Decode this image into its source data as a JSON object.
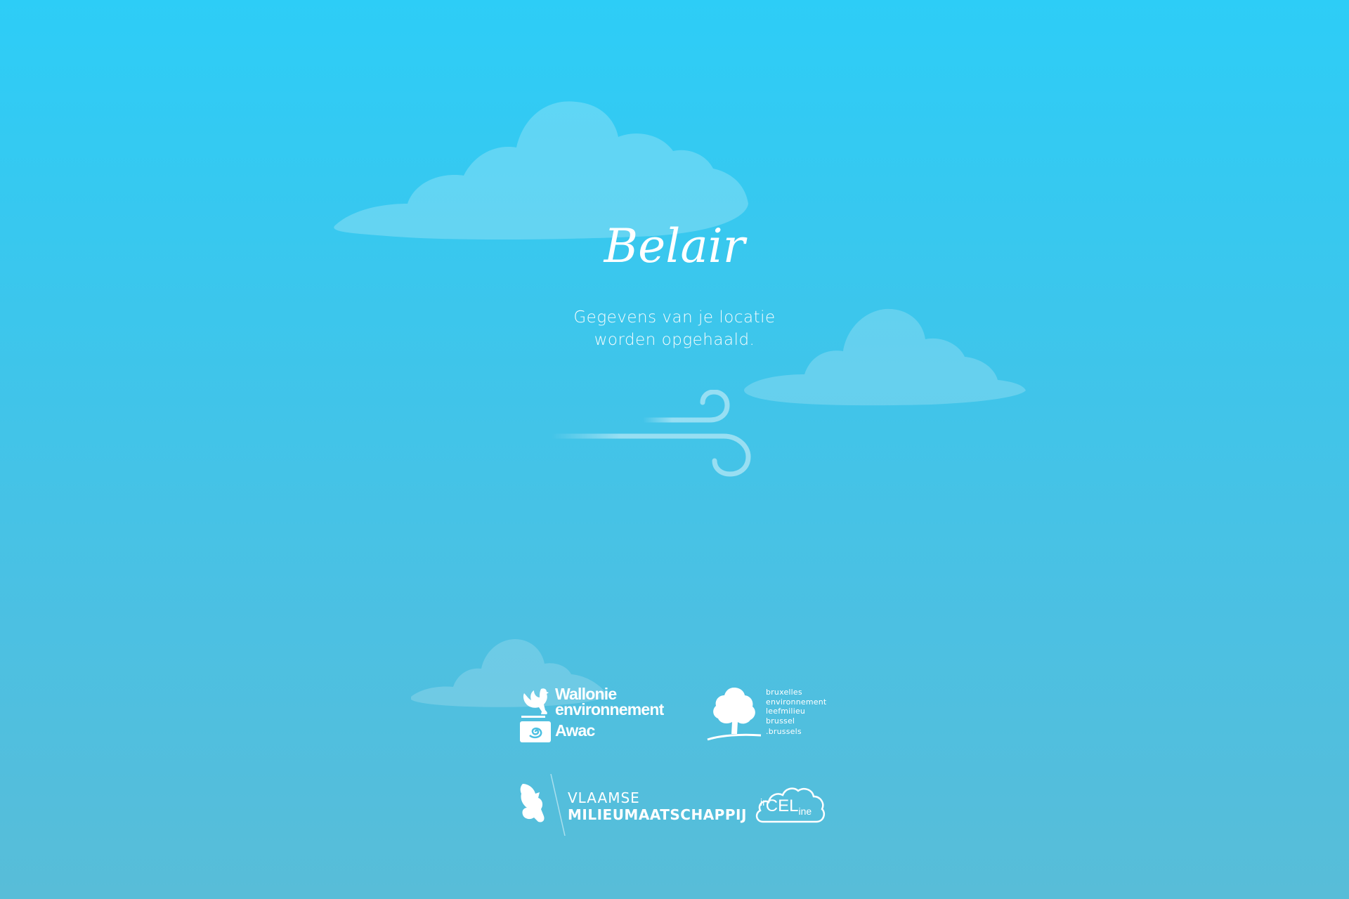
{
  "app": {
    "title": "Belair",
    "status_lines": [
      "Gegevens van je locatie",
      "worden opgehaald."
    ]
  },
  "icons": {
    "loading": "wind-icon",
    "decoration": "cloud-icon"
  },
  "partners": {
    "wallonie": {
      "lines": [
        "Wallonie",
        "environnement",
        "Awac"
      ]
    },
    "brussels": {
      "lines": [
        "bruxelles",
        "environnement",
        "leefmilieu",
        "brussel",
        ".brussels"
      ]
    },
    "vmm": {
      "lines": [
        "VLAAMSE",
        "MILIEUMAATSCHAPPIJ"
      ]
    },
    "irceline": {
      "parts": [
        "ir",
        "CEL",
        "ine"
      ]
    }
  },
  "colors": {
    "sky_top": "#2dcdf7",
    "sky_bottom": "#58bdd8",
    "foreground": "#ffffff"
  }
}
